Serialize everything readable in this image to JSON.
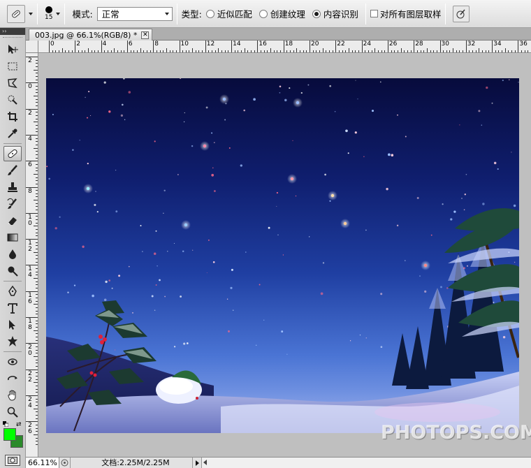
{
  "options_bar": {
    "tool_icon": "spot-healing-brush-icon",
    "brush_size": "15",
    "mode_label": "模式:",
    "mode_value": "正常",
    "type_label": "类型:",
    "type_options": [
      {
        "label": "近似匹配",
        "selected": false
      },
      {
        "label": "创建纹理",
        "selected": false
      },
      {
        "label": "内容识别",
        "selected": true
      }
    ],
    "sample_all_layers_label": "对所有图层取样",
    "sample_all_layers_checked": false,
    "pressure_icon": "tablet-pressure-icon"
  },
  "toolbox": {
    "header": "››",
    "foreground_color": "#00ff00",
    "background_color": "#2a8a2a"
  },
  "document": {
    "tab_title": "003.jpg @ 66.1%(RGB/8) *",
    "close_symbol": "✕"
  },
  "rulers": {
    "horizontal": [
      "0",
      "2",
      "4",
      "6",
      "8",
      "10",
      "12",
      "14",
      "16",
      "18",
      "20",
      "22",
      "24",
      "26",
      "28",
      "30",
      "32",
      "34",
      "36"
    ],
    "vertical": [
      "2",
      "0",
      "2",
      "4",
      "6",
      "8",
      "10",
      "12",
      "14",
      "16",
      "18",
      "20",
      "22",
      "24",
      "26"
    ]
  },
  "watermark": "PHOTOPS.COM",
  "status_bar": {
    "zoom": "66.11%",
    "doc_info": "文档:2.25M/2.25M"
  }
}
